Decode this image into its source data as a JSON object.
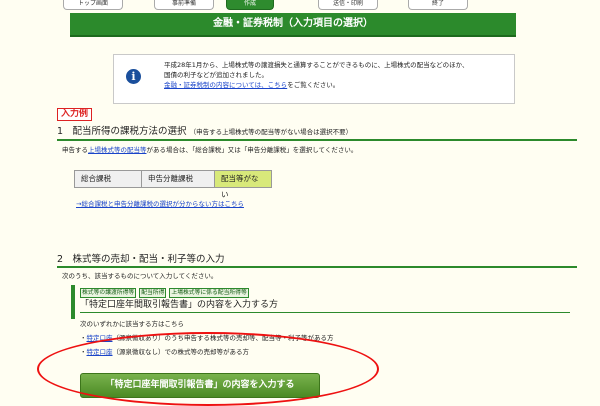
{
  "nav": {
    "tabs": [
      {
        "label": "トップ画面"
      },
      {
        "label": "事前準備"
      },
      {
        "label": "作成"
      },
      {
        "label": "送信・印刷"
      },
      {
        "label": "終了"
      }
    ]
  },
  "header": {
    "title": "金融・証券税制（入力項目の選択）"
  },
  "info": {
    "line1": "平成28年1月から、上場株式等の譲渡損失と通算することができるものに、上場株式の配当などのほか、",
    "line2": "国債の利子などが追加されました。",
    "link": "金融・証券税制の内容については、こちら",
    "line3_suffix": "をご覧ください。"
  },
  "example_label": "入力例",
  "section1": {
    "title": "1　配当所得の課税方法の選択",
    "note": "（申告する上場株式等の配当等がない場合は選択不要）",
    "desc_prefix": "申告する",
    "desc_link": "上場株式等の配当等",
    "desc_suffix": "がある場合は、「総合課税」又は「申告分離課税」を選択してください。",
    "options": [
      {
        "label": "総合課税"
      },
      {
        "label": "申告分離課税"
      },
      {
        "label": "配当等がない"
      }
    ],
    "help_link": "→総合課税と申告分離課税の選択が分からない方はこちら"
  },
  "section2": {
    "title": "2　株式等の売却・配当・利子等の入力",
    "desc": "次のうち、該当するものについて入力してください。",
    "tags": [
      {
        "label": "株式等の譲渡所得等"
      },
      {
        "label": "配当所得"
      },
      {
        "label": "上場株式等に係る配当所得等"
      }
    ],
    "subtitle": "「特定口座年間取引報告書」の内容を入力する方",
    "applies": "次のいずれかに該当する方はこちら",
    "item1_link": "特定口座",
    "item1_text": "（源泉徴収あり）のうち申告する株式等の売却等、配当等・利子等がある方",
    "item2_link": "特定口座",
    "item2_text": "（源泉徴収なし）での株式等の売却等がある方",
    "button": "「特定口座年間取引報告書」の内容を入力する"
  }
}
